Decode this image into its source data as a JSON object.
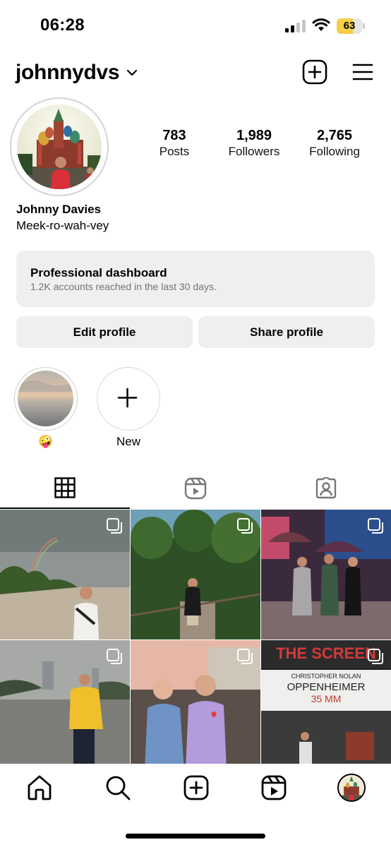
{
  "status_bar": {
    "time": "06:28",
    "battery_percent": "63",
    "battery_level": 0.63,
    "battery_color": "#f7ce46"
  },
  "header": {
    "username": "johnnydvs",
    "chevron_icon": "chevron-down-icon",
    "create_icon": "plus-square-icon",
    "menu_icon": "hamburger-menu-icon"
  },
  "profile": {
    "stats": [
      {
        "value": "783",
        "label": "Posts"
      },
      {
        "value": "1,989",
        "label": "Followers"
      },
      {
        "value": "2,765",
        "label": "Following"
      }
    ],
    "display_name": "Johnny Davies",
    "bio": "Meek-ro-wah-vey"
  },
  "dashboard": {
    "title": "Professional dashboard",
    "subtitle": "1.2K accounts reached in the last 30 days."
  },
  "buttons": {
    "edit_profile": "Edit profile",
    "share_profile": "Share profile"
  },
  "highlights": [
    {
      "label": "🤪"
    },
    {
      "label": "New"
    }
  ],
  "tabs": [
    {
      "name": "posts",
      "icon": "grid-icon",
      "active": true
    },
    {
      "name": "reels",
      "icon": "reels-icon",
      "active": false
    },
    {
      "name": "tagged",
      "icon": "tagged-person-icon",
      "active": false
    }
  ],
  "posts": [
    {
      "text": ""
    },
    {
      "text": ""
    },
    {
      "text": ""
    },
    {
      "text": ""
    },
    {
      "text": ""
    },
    {
      "marquee_top": "THE SCREEN",
      "marquee_line1": "CHRISTOPHER NOLAN",
      "marquee_line2": "OPPENHEIMER",
      "marquee_line3": "35 MM"
    }
  ],
  "bottom_nav": [
    {
      "icon": "home-icon"
    },
    {
      "icon": "search-icon"
    },
    {
      "icon": "create-icon"
    },
    {
      "icon": "reels-icon"
    },
    {
      "icon": "profile-avatar"
    }
  ]
}
